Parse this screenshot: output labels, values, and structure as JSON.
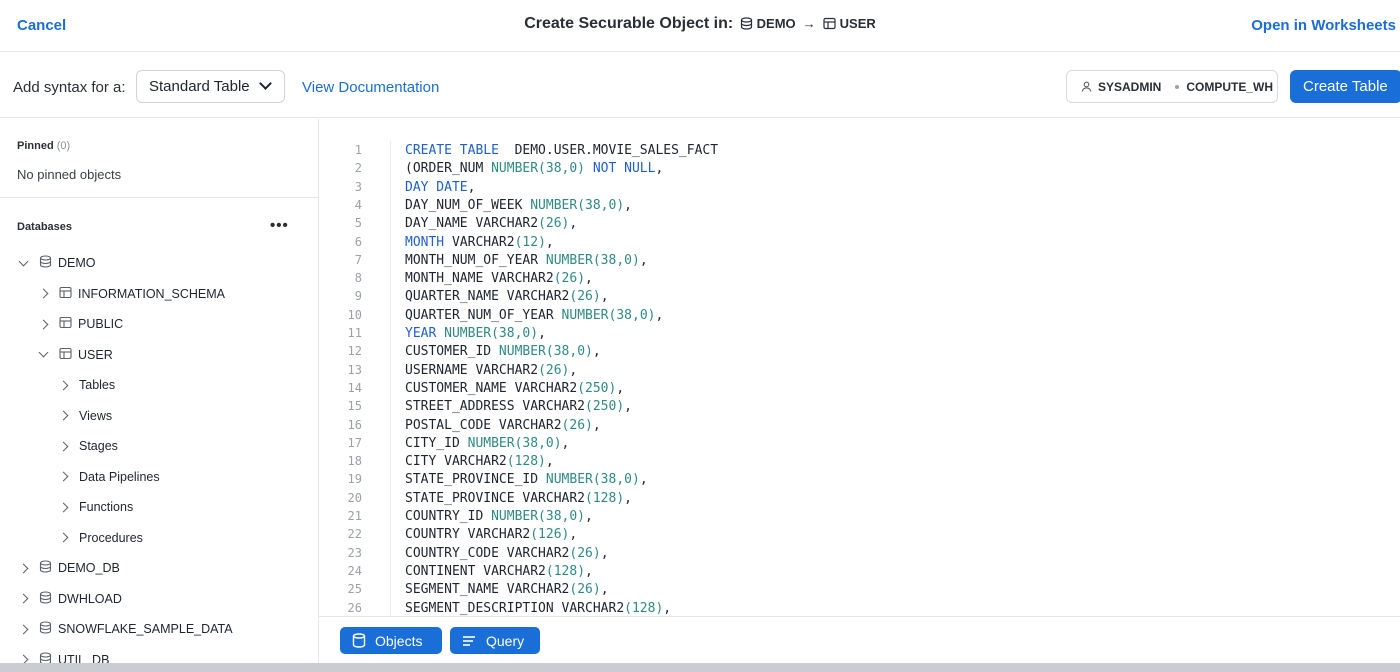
{
  "header": {
    "cancel_label": "Cancel",
    "title": "Create Securable Object in:",
    "breadcrumb_db": "DEMO",
    "breadcrumb_arrow": "→",
    "breadcrumb_schema": "USER",
    "open_worksheets_label": "Open in Worksheets"
  },
  "toolbar": {
    "syntax_label": "Add syntax for a:",
    "syntax_select_value": "Standard Table",
    "view_doc_label": "View Documentation",
    "role": "SYSADMIN",
    "warehouse": "COMPUTE_WH",
    "create_label": "Create Table"
  },
  "sidebar": {
    "pinned_title": "Pinned",
    "pinned_count": "(0)",
    "pinned_empty": "No pinned objects",
    "databases_title": "Databases",
    "more_label": "•••",
    "tree": [
      {
        "label": "DEMO",
        "icon": "database-icon",
        "level": 0,
        "state": "down"
      },
      {
        "label": "INFORMATION_SCHEMA",
        "icon": "schema-icon",
        "level": 1,
        "state": "right"
      },
      {
        "label": "PUBLIC",
        "icon": "schema-icon",
        "level": 1,
        "state": "right"
      },
      {
        "label": "USER",
        "icon": "schema-icon",
        "level": 1,
        "state": "down"
      },
      {
        "label": "Tables",
        "icon": "",
        "level": 2,
        "state": "right"
      },
      {
        "label": "Views",
        "icon": "",
        "level": 2,
        "state": "right"
      },
      {
        "label": "Stages",
        "icon": "",
        "level": 2,
        "state": "right"
      },
      {
        "label": "Data Pipelines",
        "icon": "",
        "level": 2,
        "state": "right"
      },
      {
        "label": "Functions",
        "icon": "",
        "level": 2,
        "state": "right"
      },
      {
        "label": "Procedures",
        "icon": "",
        "level": 2,
        "state": "right"
      },
      {
        "label": "DEMO_DB",
        "icon": "database-icon",
        "level": 0,
        "state": "right"
      },
      {
        "label": "DWHLOAD",
        "icon": "database-icon",
        "level": 0,
        "state": "right"
      },
      {
        "label": "SNOWFLAKE_SAMPLE_DATA",
        "icon": "database-icon",
        "level": 0,
        "state": "right"
      },
      {
        "label": "UTIL_DB",
        "icon": "database-icon",
        "level": 0,
        "state": "right"
      }
    ]
  },
  "editor": {
    "lines": [
      {
        "n": "1",
        "tokens": [
          [
            "kw",
            "CREATE TABLE"
          ],
          [
            "",
            "  DEMO.USER.MOVIE_SALES_FACT"
          ]
        ]
      },
      {
        "n": "2",
        "tokens": [
          [
            "",
            "(ORDER_NUM "
          ],
          [
            "ty",
            "NUMBER(38,0)"
          ],
          [
            "",
            ""
          ],
          [
            "kw",
            " NOT NULL"
          ],
          [
            "",
            ","
          ]
        ]
      },
      {
        "n": "3",
        "tokens": [
          [
            "kw",
            "DAY DATE"
          ],
          [
            "",
            ","
          ]
        ]
      },
      {
        "n": "4",
        "tokens": [
          [
            "",
            "DAY_NUM_OF_WEEK "
          ],
          [
            "ty",
            "NUMBER(38,0)"
          ],
          [
            "",
            ","
          ]
        ]
      },
      {
        "n": "5",
        "tokens": [
          [
            "",
            "DAY_NAME VARCHAR2"
          ],
          [
            "ty",
            "(26)"
          ],
          [
            "",
            ","
          ]
        ]
      },
      {
        "n": "6",
        "tokens": [
          [
            "kw",
            "MONTH"
          ],
          [
            "",
            " VARCHAR2"
          ],
          [
            "ty",
            "(12)"
          ],
          [
            "",
            ","
          ]
        ]
      },
      {
        "n": "7",
        "tokens": [
          [
            "",
            "MONTH_NUM_OF_YEAR "
          ],
          [
            "ty",
            "NUMBER(38,0)"
          ],
          [
            "",
            ","
          ]
        ]
      },
      {
        "n": "8",
        "tokens": [
          [
            "",
            "MONTH_NAME VARCHAR2"
          ],
          [
            "ty",
            "(26)"
          ],
          [
            "",
            ","
          ]
        ]
      },
      {
        "n": "9",
        "tokens": [
          [
            "",
            "QUARTER_NAME VARCHAR2"
          ],
          [
            "ty",
            "(26)"
          ],
          [
            "",
            ","
          ]
        ]
      },
      {
        "n": "10",
        "tokens": [
          [
            "",
            "QUARTER_NUM_OF_YEAR "
          ],
          [
            "ty",
            "NUMBER(38,0)"
          ],
          [
            "",
            ","
          ]
        ]
      },
      {
        "n": "11",
        "tokens": [
          [
            "kw",
            "YEAR"
          ],
          [
            "ty",
            " NUMBER(38,0)"
          ],
          [
            "",
            ","
          ]
        ]
      },
      {
        "n": "12",
        "tokens": [
          [
            "",
            "CUSTOMER_ID "
          ],
          [
            "ty",
            "NUMBER(38,0)"
          ],
          [
            "",
            ","
          ]
        ]
      },
      {
        "n": "13",
        "tokens": [
          [
            "",
            "USERNAME VARCHAR2"
          ],
          [
            "ty",
            "(26)"
          ],
          [
            "",
            ","
          ]
        ]
      },
      {
        "n": "14",
        "tokens": [
          [
            "",
            "CUSTOMER_NAME VARCHAR2"
          ],
          [
            "ty",
            "(250)"
          ],
          [
            "",
            ","
          ]
        ]
      },
      {
        "n": "15",
        "tokens": [
          [
            "",
            "STREET_ADDRESS VARCHAR2"
          ],
          [
            "ty",
            "(250)"
          ],
          [
            "",
            ","
          ]
        ]
      },
      {
        "n": "16",
        "tokens": [
          [
            "",
            "POSTAL_CODE VARCHAR2"
          ],
          [
            "ty",
            "(26)"
          ],
          [
            "",
            ","
          ]
        ]
      },
      {
        "n": "17",
        "tokens": [
          [
            "",
            "CITY_ID "
          ],
          [
            "ty",
            "NUMBER(38,0)"
          ],
          [
            "",
            ","
          ]
        ]
      },
      {
        "n": "18",
        "tokens": [
          [
            "",
            "CITY VARCHAR2"
          ],
          [
            "ty",
            "(128)"
          ],
          [
            "",
            ","
          ]
        ]
      },
      {
        "n": "19",
        "tokens": [
          [
            "",
            "STATE_PROVINCE_ID "
          ],
          [
            "ty",
            "NUMBER(38,0)"
          ],
          [
            "",
            ","
          ]
        ]
      },
      {
        "n": "20",
        "tokens": [
          [
            "",
            "STATE_PROVINCE VARCHAR2"
          ],
          [
            "ty",
            "(128)"
          ],
          [
            "",
            ","
          ]
        ]
      },
      {
        "n": "21",
        "tokens": [
          [
            "",
            "COUNTRY_ID "
          ],
          [
            "ty",
            "NUMBER(38,0)"
          ],
          [
            "",
            ","
          ]
        ]
      },
      {
        "n": "22",
        "tokens": [
          [
            "",
            "COUNTRY VARCHAR2"
          ],
          [
            "ty",
            "(126)"
          ],
          [
            "",
            ","
          ]
        ]
      },
      {
        "n": "23",
        "tokens": [
          [
            "",
            "COUNTRY_CODE VARCHAR2"
          ],
          [
            "ty",
            "(26)"
          ],
          [
            "",
            ","
          ]
        ]
      },
      {
        "n": "24",
        "tokens": [
          [
            "",
            "CONTINENT VARCHAR2"
          ],
          [
            "ty",
            "(128)"
          ],
          [
            "",
            ","
          ]
        ]
      },
      {
        "n": "25",
        "tokens": [
          [
            "",
            "SEGMENT_NAME VARCHAR2"
          ],
          [
            "ty",
            "(26)"
          ],
          [
            "",
            ","
          ]
        ]
      },
      {
        "n": "26",
        "tokens": [
          [
            "",
            "SEGMENT_DESCRIPTION VARCHAR2"
          ],
          [
            "ty",
            "(128)"
          ],
          [
            "",
            ","
          ]
        ]
      }
    ]
  },
  "bottom": {
    "objects_label": "Objects",
    "query_label": "Query"
  },
  "colors": {
    "accent": "#1a6ed8",
    "keyword": "#1f5fd0",
    "type": "#2f8a83"
  }
}
